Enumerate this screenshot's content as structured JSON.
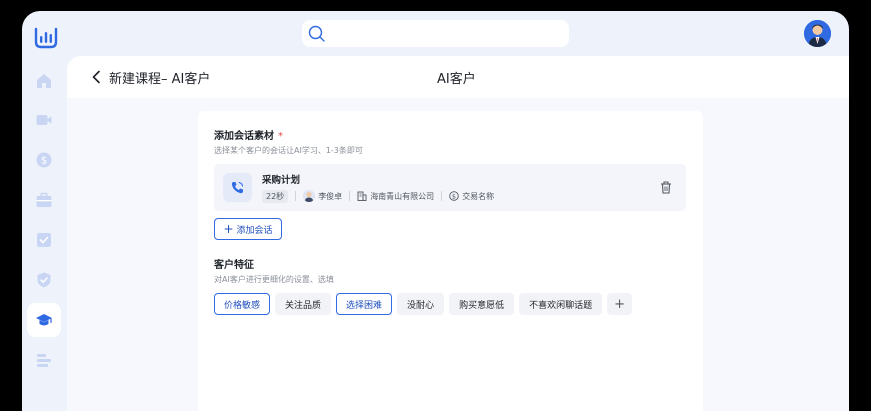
{
  "search": {
    "placeholder": ""
  },
  "header": {
    "title": "新建课程– AI客户",
    "center_title": "AI客户"
  },
  "sidebar": {
    "items": [
      {
        "name": "home",
        "icon": "home-icon"
      },
      {
        "name": "video",
        "icon": "video-icon"
      },
      {
        "name": "money",
        "icon": "dollar-icon"
      },
      {
        "name": "briefcase",
        "icon": "briefcase-icon"
      },
      {
        "name": "check",
        "icon": "check-box-icon"
      },
      {
        "name": "shield",
        "icon": "shield-icon"
      },
      {
        "name": "course",
        "icon": "graduation-cap-icon",
        "active": true
      },
      {
        "name": "chart",
        "icon": "bar-chart-icon"
      }
    ]
  },
  "material_section": {
    "title": "添加会话素材",
    "required_mark": "*",
    "subtitle": "选择某个客户的会话让AI学习、1-3条即可",
    "item": {
      "title": "采购计划",
      "duration": "22秒",
      "person": "李俊卓",
      "company": "海南青山有限公司",
      "deal": "交易名称"
    },
    "add_label": "添加会话"
  },
  "traits_section": {
    "title": "客户特征",
    "subtitle": "对AI客户进行更细化的设置、选填",
    "tags": [
      {
        "label": "价格敏感",
        "selected": true
      },
      {
        "label": "关注品质",
        "selected": false
      },
      {
        "label": "选择困难",
        "selected": true
      },
      {
        "label": "没耐心",
        "selected": false
      },
      {
        "label": "购买意愿低",
        "selected": false
      },
      {
        "label": "不喜欢闲聊话题",
        "selected": false
      }
    ],
    "add_symbol": "+"
  },
  "colors": {
    "accent": "#2f6ae3",
    "background": "#eef2fb",
    "required": "#e84a4a"
  }
}
